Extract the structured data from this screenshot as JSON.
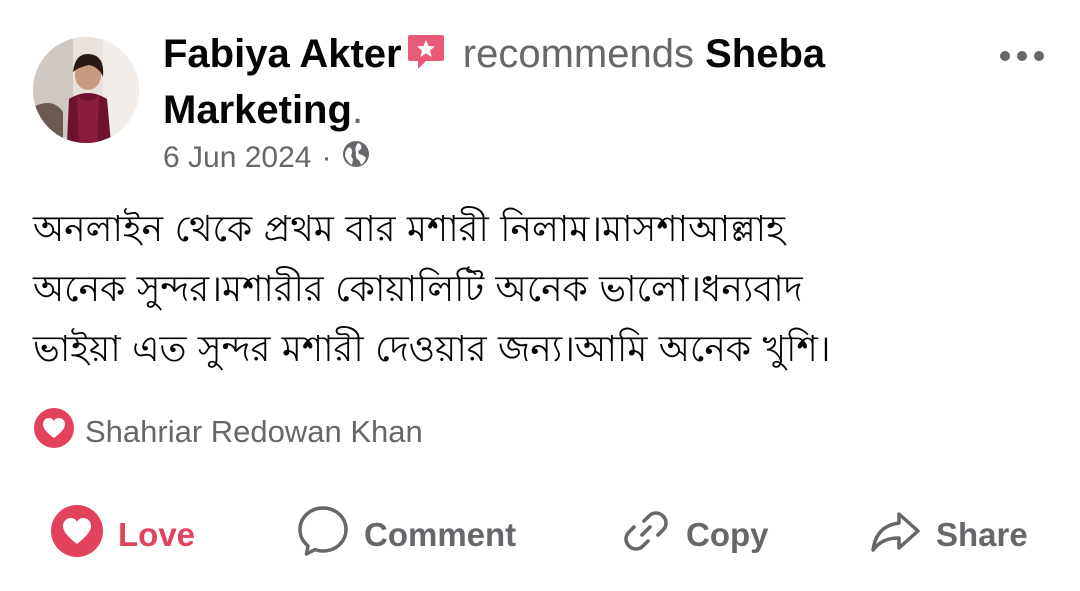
{
  "post": {
    "author": "Fabiya Akter",
    "verb": "recommends",
    "page_name": "Sheba Marketing",
    "date": "6 Jun 2024",
    "separator": "·",
    "audience_icon": "globe-icon",
    "text_lines": [
      "অনলাইন থেকে প্রথম বার মশারী নিলাম।মাসশাআল্লাহ",
      "অনেক সুন্দর।মশারীর কোয়ালিটি অনেক ভালো।ধন্যবাদ",
      "ভাইয়া এত সুন্দর মশারী দেওয়ার জন্য।আমি অনেক খুশি।"
    ]
  },
  "reactions": {
    "icon": "heart-icon",
    "names": "Shahriar Redowan Khan"
  },
  "actions": {
    "love": "Love",
    "comment": "Comment",
    "copy": "Copy",
    "share": "Share"
  },
  "colors": {
    "love_red": "#e3425d",
    "muted": "#65676b",
    "badge_pink": "#e85a7a"
  }
}
